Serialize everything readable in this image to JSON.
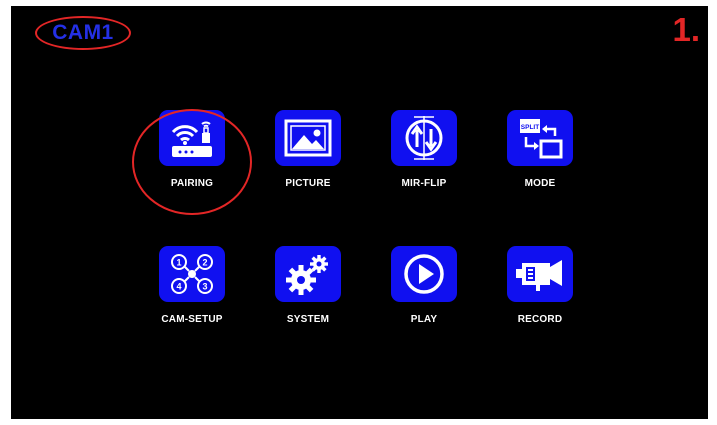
{
  "camera_indicator": {
    "label": "CAM1"
  },
  "step_marker": {
    "label": "1."
  },
  "menu": {
    "items": [
      {
        "label": "PAIRING",
        "icon": "wifi-router-icon",
        "highlighted": true
      },
      {
        "label": "PICTURE",
        "icon": "picture-icon",
        "highlighted": false
      },
      {
        "label": "MIR-FLIP",
        "icon": "mirror-flip-icon",
        "highlighted": false
      },
      {
        "label": "MODE",
        "icon": "split-mode-icon",
        "highlighted": false
      },
      {
        "label": "CAM-SETUP",
        "icon": "cam-setup-icon",
        "highlighted": false
      },
      {
        "label": "SYSTEM",
        "icon": "gears-icon",
        "highlighted": false
      },
      {
        "label": "PLAY",
        "icon": "play-icon",
        "highlighted": false
      },
      {
        "label": "RECORD",
        "icon": "video-camera-icon",
        "highlighted": false
      }
    ]
  },
  "icon_text": {
    "split": "SPLIT"
  },
  "colors": {
    "background": "#000000",
    "tile": "#1010f0",
    "label": "#ffffff",
    "annotation": "#e32626",
    "cam_text": "#2430e6"
  }
}
